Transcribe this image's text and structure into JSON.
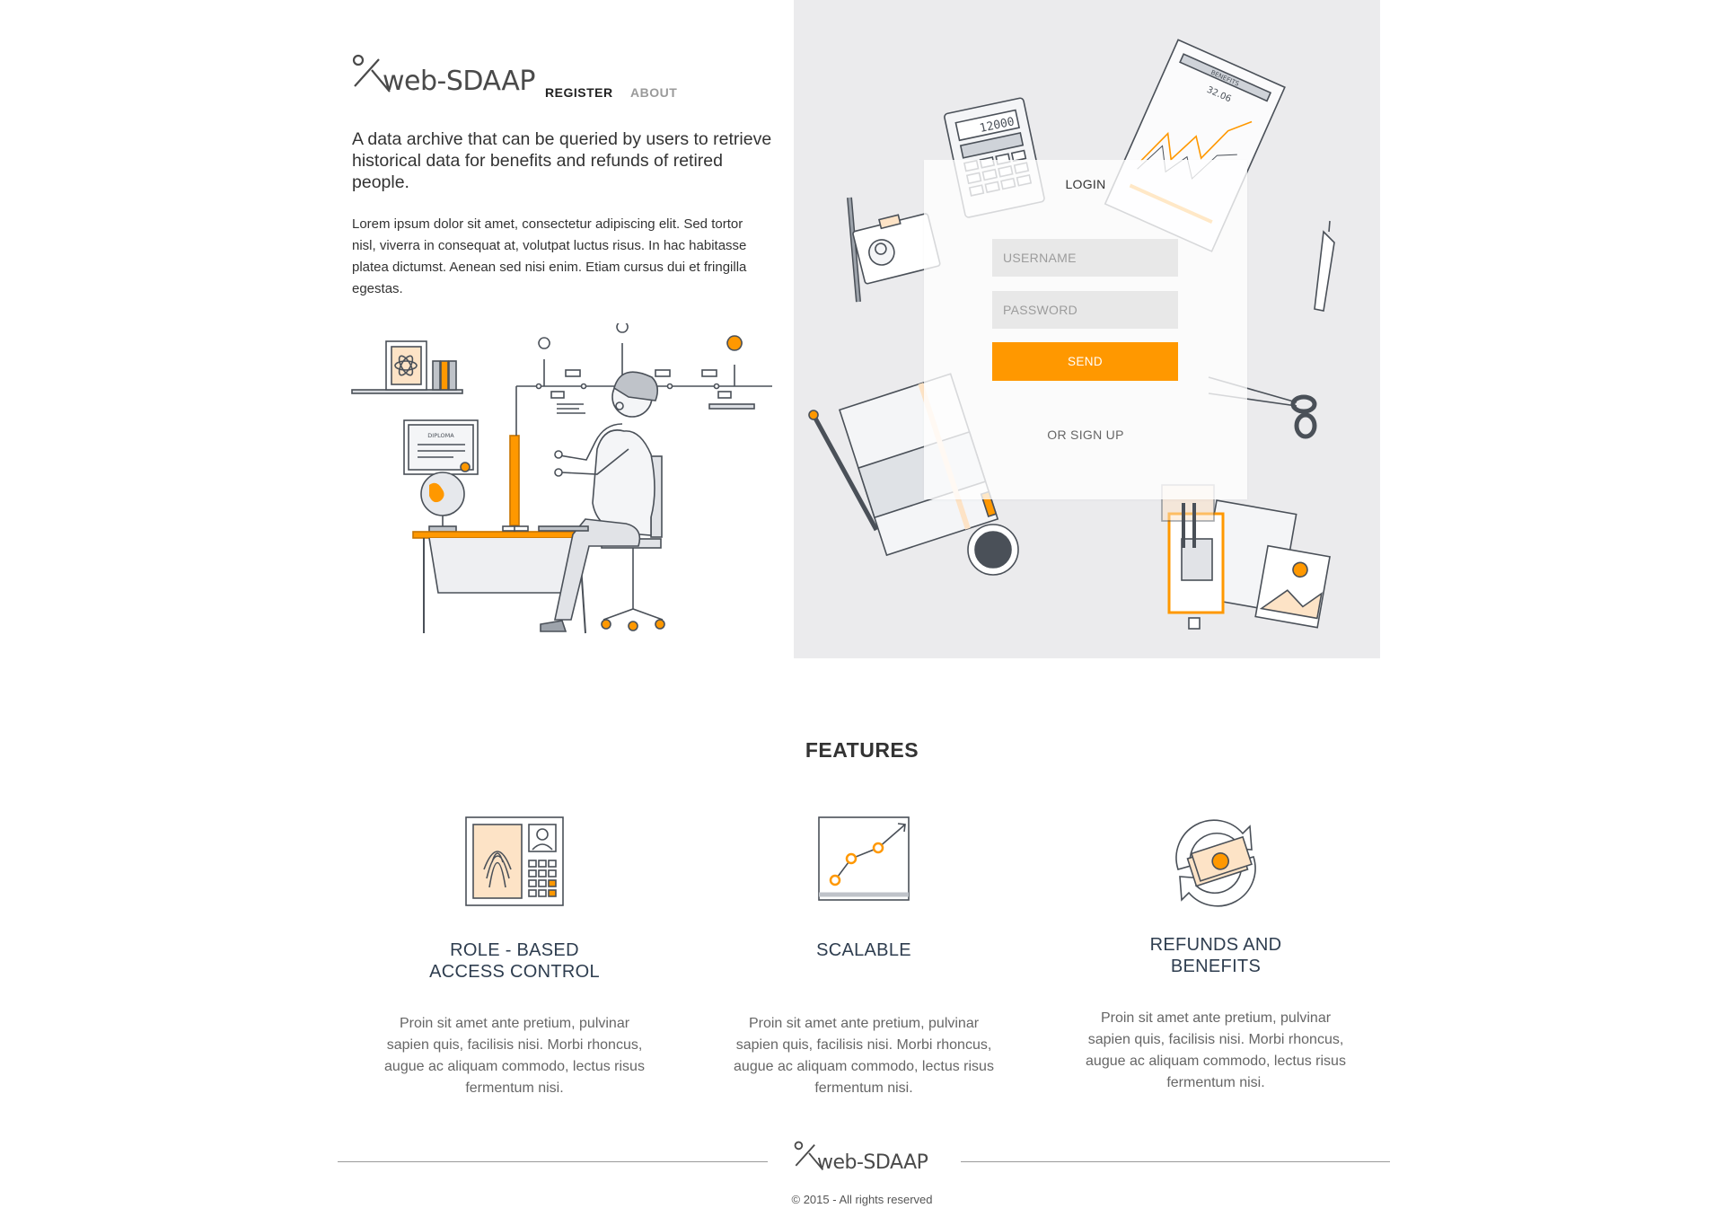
{
  "header": {
    "logo_text": "web-SDAAP",
    "nav": {
      "register": "REGISTER",
      "about": "ABOUT"
    }
  },
  "hero": {
    "tagline": "A data archive that can be queried by users to retrieve historical data for benefits and refunds of retired people.",
    "intro": "Lorem ipsum dolor sit amet, consectetur adipiscing elit. Sed tortor nisl, viverra in consequat at, volutpat luctus risus. In hac habitasse platea dictumst. Aenean sed nisi enim. Etiam cursus dui et fringilla egestas."
  },
  "login": {
    "title": "LOGIN",
    "username_placeholder": "USERNAME",
    "password_placeholder": "PASSWORD",
    "send_label": "SEND",
    "signup_label": "OR SIGN UP"
  },
  "illustrations": {
    "diploma_label": "DIPLOMA",
    "chart_label": "BENEFITS",
    "chart_value": "32.06",
    "calculator_display": "12000"
  },
  "features": {
    "heading": "FEATURES",
    "items": [
      {
        "title_line1": "ROLE - BASED",
        "title_line2": "ACCESS CONTROL",
        "icon": "fingerprint-id-icon",
        "desc": "Proin sit amet ante pretium, pulvinar sapien quis, facilisis nisi. Morbi rhoncus, augue ac aliquam commodo, lectus risus fermentum nisi."
      },
      {
        "title_line1": "SCALABLE",
        "title_line2": "",
        "icon": "growth-chart-icon",
        "desc": "Proin sit amet ante pretium, pulvinar sapien quis, facilisis nisi. Morbi rhoncus, augue ac aliquam commodo, lectus risus fermentum nisi."
      },
      {
        "title_line1": "REFUNDS AND",
        "title_line2": "BENEFITS",
        "icon": "money-refund-icon",
        "desc": "Proin sit amet ante pretium, pulvinar sapien quis, facilisis nisi. Morbi rhoncus, augue ac aliquam commodo, lectus risus fermentum nisi."
      }
    ]
  },
  "footer": {
    "logo_text": "web-SDAAP",
    "copyright": "© 2015 - All rights reserved"
  },
  "colors": {
    "accent": "#ff9800",
    "panel_bg": "#ebebed",
    "line_art": "#4a5058",
    "text": "#333333",
    "heading_blue": "#2e3d4f"
  }
}
